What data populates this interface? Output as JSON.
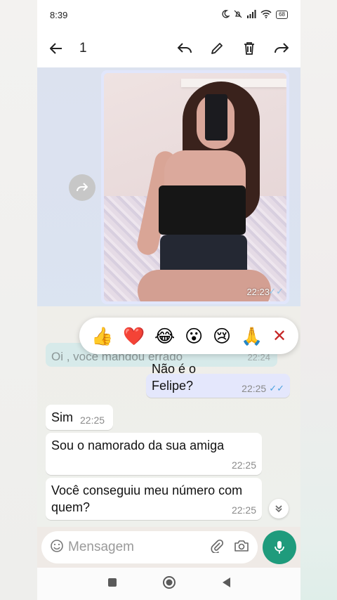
{
  "status_bar": {
    "time": "8:39",
    "battery": "68",
    "icons": [
      "moon-icon",
      "mute-icon",
      "signal-icon",
      "wifi-icon",
      "battery-icon"
    ]
  },
  "action_bar": {
    "selection_count": "1",
    "icons": [
      "back-arrow-icon",
      "reply-icon",
      "edit-icon",
      "delete-icon",
      "forward-icon"
    ]
  },
  "messages": {
    "image": {
      "time": "22:23",
      "ticks": "✓✓"
    },
    "faded": {
      "text": "Oi , você mandou errado",
      "time": "22:24"
    },
    "outgoing": {
      "text": "Não é o Felipe?",
      "time": "22:25",
      "ticks": "✓✓"
    },
    "incoming": [
      {
        "text": "Sim",
        "time": "22:25"
      },
      {
        "text": "Sou o namorado da sua amiga",
        "time": "22:25"
      },
      {
        "text": "Você conseguiu meu número com quem?",
        "time": "22:25"
      }
    ]
  },
  "reactions": [
    "👍",
    "❤️",
    "😂",
    "😮",
    "😢",
    "🙏"
  ],
  "reaction_close": "✕",
  "input": {
    "placeholder": "Mensagem"
  },
  "colors": {
    "accent": "#1f9b7c",
    "outgoing_bubble": "#e4e7fc",
    "selection": "#c3d7fa"
  }
}
